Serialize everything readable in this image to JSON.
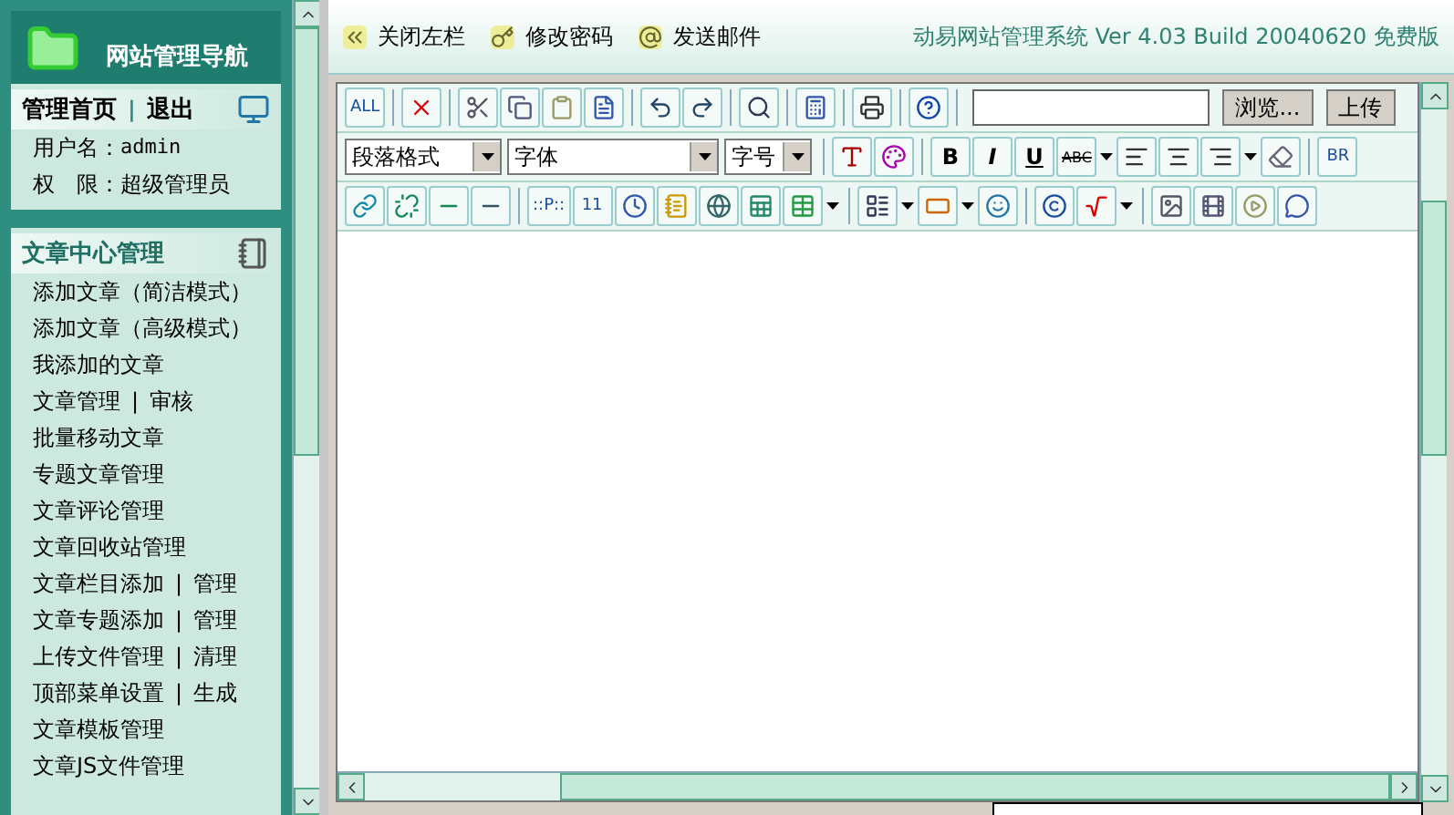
{
  "sidebar": {
    "title": "网站管理导航",
    "account": {
      "links": [
        "管理首页",
        "退出"
      ],
      "separator": "|",
      "user_label": "用户名：",
      "user": "admin",
      "role_label": "权　限：",
      "role": "超级管理员"
    },
    "section": {
      "title": "文章中心管理",
      "separator": "|",
      "items": [
        {
          "links": [
            "添加文章（简洁模式）"
          ]
        },
        {
          "links": [
            "添加文章（高级模式）"
          ]
        },
        {
          "links": [
            "我添加的文章"
          ]
        },
        {
          "links": [
            "文章管理",
            "审核"
          ]
        },
        {
          "links": [
            "批量移动文章"
          ]
        },
        {
          "links": [
            "专题文章管理"
          ]
        },
        {
          "links": [
            "文章评论管理"
          ]
        },
        {
          "links": [
            "文章回收站管理"
          ]
        },
        {
          "links": [
            "文章栏目添加",
            "管理"
          ]
        },
        {
          "links": [
            "文章专题添加",
            "管理"
          ]
        },
        {
          "links": [
            "上传文件管理",
            "清理"
          ]
        },
        {
          "links": [
            "顶部菜单设置",
            "生成"
          ]
        },
        {
          "links": [
            "文章模板管理"
          ]
        },
        {
          "links": [
            "文章JS文件管理"
          ]
        }
      ]
    }
  },
  "topbar": {
    "links": [
      "关闭左栏",
      "修改密码",
      "发送邮件"
    ],
    "title": "动易网站管理系统 Ver 4.03 Build 20040620 免费版"
  },
  "toolbars": [
    [
      {
        "kind": "text",
        "label": "ALL"
      },
      {
        "kind": "sep"
      },
      {
        "kind": "icon"
      },
      {
        "kind": "sep"
      },
      {
        "kind": "icon"
      },
      {
        "kind": "icon"
      },
      {
        "kind": "icon"
      },
      {
        "kind": "icon"
      },
      {
        "kind": "sep"
      },
      {
        "kind": "icon"
      },
      {
        "kind": "icon"
      },
      {
        "kind": "sep"
      },
      {
        "kind": "icon"
      },
      {
        "kind": "sep"
      },
      {
        "kind": "icon"
      },
      {
        "kind": "sep"
      },
      {
        "kind": "icon"
      },
      {
        "kind": "sep"
      },
      {
        "kind": "icon"
      },
      {
        "kind": "sep"
      },
      {
        "kind": "input"
      },
      {
        "kind": "button",
        "label": "浏览..."
      },
      {
        "kind": "button",
        "label": "上传"
      }
    ],
    [
      {
        "kind": "select",
        "value": "段落格式"
      },
      {
        "kind": "select",
        "value": "字体"
      },
      {
        "kind": "select",
        "value": "字号"
      },
      {
        "kind": "sep"
      },
      {
        "kind": "icon"
      },
      {
        "kind": "icon"
      },
      {
        "kind": "sep"
      },
      {
        "kind": "bold",
        "label": "B"
      },
      {
        "kind": "italic",
        "label": "I"
      },
      {
        "kind": "underline",
        "label": "U"
      },
      {
        "kind": "strike",
        "label": "ABC"
      },
      {
        "kind": "caret"
      },
      {
        "kind": "icon"
      },
      {
        "kind": "icon"
      },
      {
        "kind": "icon"
      },
      {
        "kind": "caret"
      },
      {
        "kind": "icon"
      },
      {
        "kind": "sep"
      },
      {
        "kind": "text",
        "label": "BR"
      }
    ],
    [
      {
        "kind": "icon"
      },
      {
        "kind": "icon"
      },
      {
        "kind": "icon"
      },
      {
        "kind": "icon"
      },
      {
        "kind": "sep"
      },
      {
        "kind": "text",
        "label": "::P::"
      },
      {
        "kind": "text",
        "label": "11"
      },
      {
        "kind": "icon"
      },
      {
        "kind": "icon"
      },
      {
        "kind": "icon"
      },
      {
        "kind": "icon"
      },
      {
        "kind": "icon"
      },
      {
        "kind": "caret"
      },
      {
        "kind": "sep"
      },
      {
        "kind": "icon"
      },
      {
        "kind": "caret"
      },
      {
        "kind": "icon"
      },
      {
        "kind": "caret"
      },
      {
        "kind": "icon"
      },
      {
        "kind": "sep"
      },
      {
        "kind": "icon"
      },
      {
        "kind": "icon"
      },
      {
        "kind": "caret"
      },
      {
        "kind": "sep"
      },
      {
        "kind": "icon"
      },
      {
        "kind": "icon"
      },
      {
        "kind": "icon"
      },
      {
        "kind": "icon"
      }
    ]
  ]
}
